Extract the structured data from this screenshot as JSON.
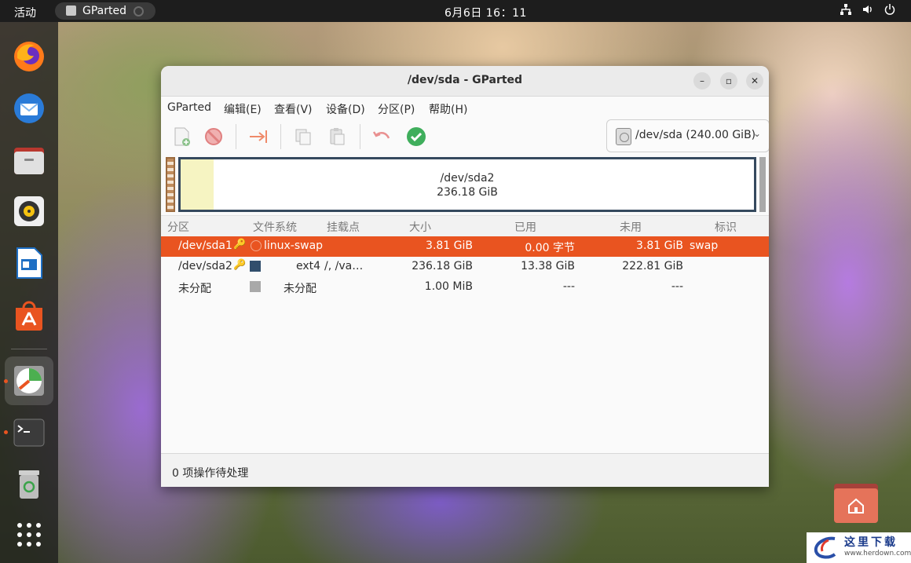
{
  "topbar": {
    "activities": "活动",
    "app_name": "GParted",
    "clock": "6月6日  16：11"
  },
  "window": {
    "title": "/dev/sda - GParted",
    "menu": [
      "GParted",
      "编辑(E)",
      "查看(V)",
      "设备(D)",
      "分区(P)",
      "帮助(H)"
    ],
    "device_selector": "/dev/sda (240.00 GiB)"
  },
  "partition_map": {
    "label": "/dev/sda2",
    "size": "236.18 GiB"
  },
  "table": {
    "headers": [
      "分区",
      "文件系统",
      "挂载点",
      "大小",
      "已用",
      "未用",
      "标识"
    ],
    "rows": [
      {
        "partition": "/dev/sda1",
        "filesystem": "linux-swap",
        "mount": "",
        "size": "3.81 GiB",
        "used": "0.00 字节",
        "unused": "3.81 GiB",
        "flags": "swap",
        "color": "#c1665a",
        "selected": true
      },
      {
        "partition": "/dev/sda2",
        "filesystem": "ext4",
        "mount": "/, /va…",
        "size": "236.18 GiB",
        "used": "13.38 GiB",
        "unused": "222.81 GiB",
        "flags": "",
        "color": "#314e6c",
        "selected": false
      },
      {
        "partition": "未分配",
        "filesystem": "未分配",
        "mount": "",
        "size": "1.00 MiB",
        "used": "---",
        "unused": "---",
        "flags": "",
        "color": "#a9a9a9",
        "selected": false
      }
    ]
  },
  "status": "0 项操作待处理",
  "watermark": {
    "title": "这里下载",
    "url": "www.herdown.com"
  },
  "colors": {
    "accent": "#e95420",
    "dock_bg": "#1e1e1e"
  }
}
